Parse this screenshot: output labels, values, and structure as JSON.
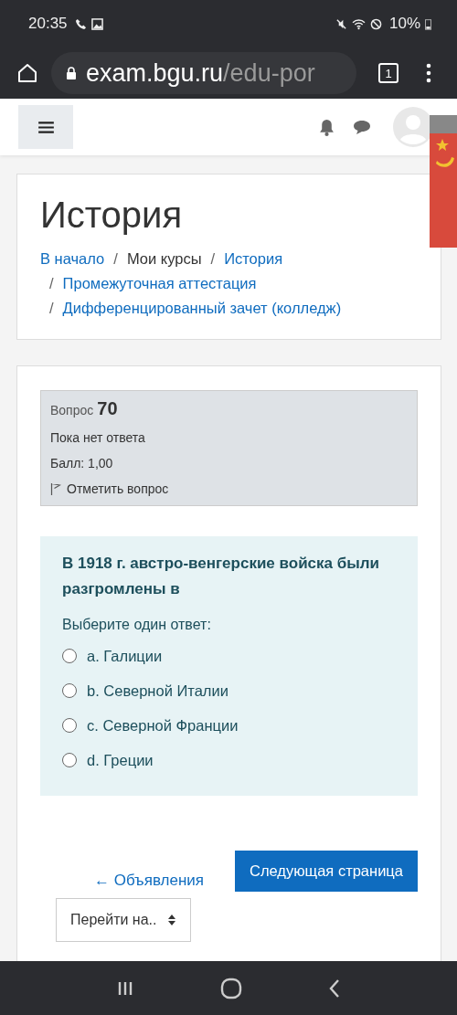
{
  "status_bar": {
    "time": "20:35",
    "battery": "10%"
  },
  "browser": {
    "url_host": "exam.bgu.ru",
    "url_path": "/edu-por",
    "tab_count": "1"
  },
  "course": {
    "title": "История",
    "breadcrumb": [
      {
        "label": "В начало",
        "link": true
      },
      {
        "label": "Мои курсы",
        "link": false,
        "separator": "/"
      },
      {
        "label": "История",
        "link": true,
        "separator": "/"
      },
      {
        "label": "Промежуточная аттестация",
        "link": true,
        "separator": "/"
      },
      {
        "label": "Дифференцированный зачет (колледж)",
        "link": true,
        "separator": "/"
      }
    ]
  },
  "question_info": {
    "label": "Вопрос",
    "number": "70",
    "status": "Пока нет ответа",
    "score": "Балл: 1,00",
    "flag": "Отметить вопрос"
  },
  "question": {
    "text": "В 1918 г. австро-венгерские войска были разгромлены в",
    "prompt": "Выберите один ответ:",
    "options": [
      {
        "label": "a. Галиции",
        "selected": false
      },
      {
        "label": "b. Северной Италии",
        "selected": false
      },
      {
        "label": "c. Северной Франции",
        "selected": false
      },
      {
        "label": "d. Греции",
        "selected": false
      }
    ]
  },
  "navigation": {
    "previous": "← Объявления",
    "next": "Следующая страница",
    "jump": "Перейти на.."
  }
}
